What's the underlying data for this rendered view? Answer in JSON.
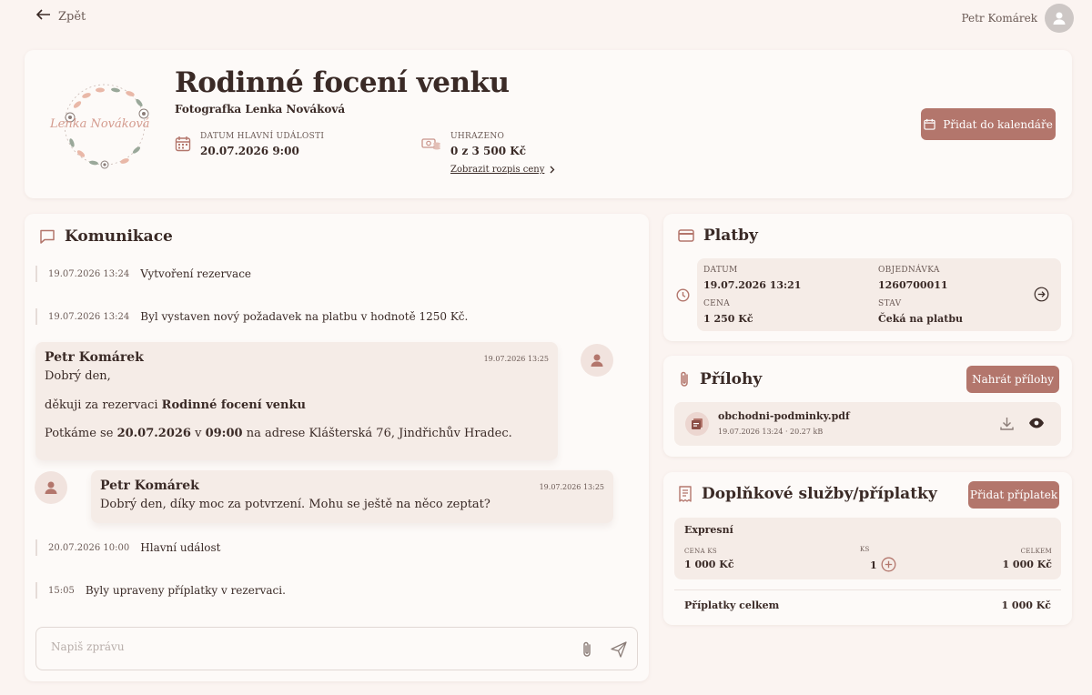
{
  "topbar": {
    "back_label": "Zpět",
    "user_name": "Petr Komárek"
  },
  "hero": {
    "logo_text": "Lenka Nováková",
    "title": "Rodinné focení venku",
    "subtitle": "Fotografka Lenka Nováková",
    "date_label": "DATUM HLAVNÍ UDÁLOSTI",
    "date_value": "20.07.2026 9:00",
    "paid_label": "UHRAZENO",
    "paid_value": "0 z 3 500 Kč",
    "price_link": "Zobrazit rozpis ceny",
    "calendar_button": "Přidat do kalendáře"
  },
  "communication": {
    "title": "Komunikace",
    "events": [
      {
        "time": "19.07.2026 13:24",
        "text": "Vytvoření rezervace"
      },
      {
        "time": "19.07.2026 13:24",
        "text": "Byl vystaven nový požadavek na platbu v hodnotě 1250 Kč."
      },
      {
        "time": "20.07.2026 10:00",
        "text": "Hlavní událost"
      },
      {
        "time": "15:05",
        "text": "Byly upraveny příplatky v rezervaci."
      }
    ],
    "message1": {
      "author": "Petr Komárek",
      "time": "19.07.2026 13:25",
      "line1": "Dobrý den,",
      "line2_prefix": "děkuji za rezervaci ",
      "line2_bold": "Rodinné focení venku",
      "line3_prefix": "Potkáme se ",
      "line3_date": "20.07.2026",
      "line3_mid": " v ",
      "line3_time": "09:00",
      "line3_suffix": " na adrese Klášterská 76, Jindřichův Hradec."
    },
    "message2": {
      "author": "Petr Komárek",
      "time": "19.07.2026 13:25",
      "text": "Dobrý den, díky moc za potvrzení. Mohu se ještě na něco zeptat?"
    },
    "composer_placeholder": "Napiš zprávu"
  },
  "payments": {
    "title": "Platby",
    "date_label": "DATUM",
    "date_value": "19.07.2026 13:21",
    "order_label": "OBJEDNÁVKA",
    "order_value": "1260700011",
    "price_label": "CENA",
    "price_value": "1 250 Kč",
    "status_label": "STAV",
    "status_value": "Čeká na platbu"
  },
  "attachments": {
    "title": "Přílohy",
    "upload_button": "Nahrát přílohy",
    "file_name": "obchodni-podminky.pdf",
    "file_meta": "19.07.2026 13:24 · 20.27 kB"
  },
  "services": {
    "title": "Doplňkové služby/příplatky",
    "add_button": "Přidat příplatek",
    "item_name": "Expresní",
    "price_label": "CENA KS",
    "price_value": "1 000 Kč",
    "qty_label": "KS",
    "qty_value": "1",
    "total_label": "CELKEM",
    "total_value": "1 000 Kč",
    "sum_label": "Příplatky celkem",
    "sum_value": "1 000 Kč"
  },
  "colors": {
    "accent": "#b3766c",
    "background": "#fbf4f1",
    "card": "#fdfaf8",
    "inner": "#f5ece7"
  }
}
